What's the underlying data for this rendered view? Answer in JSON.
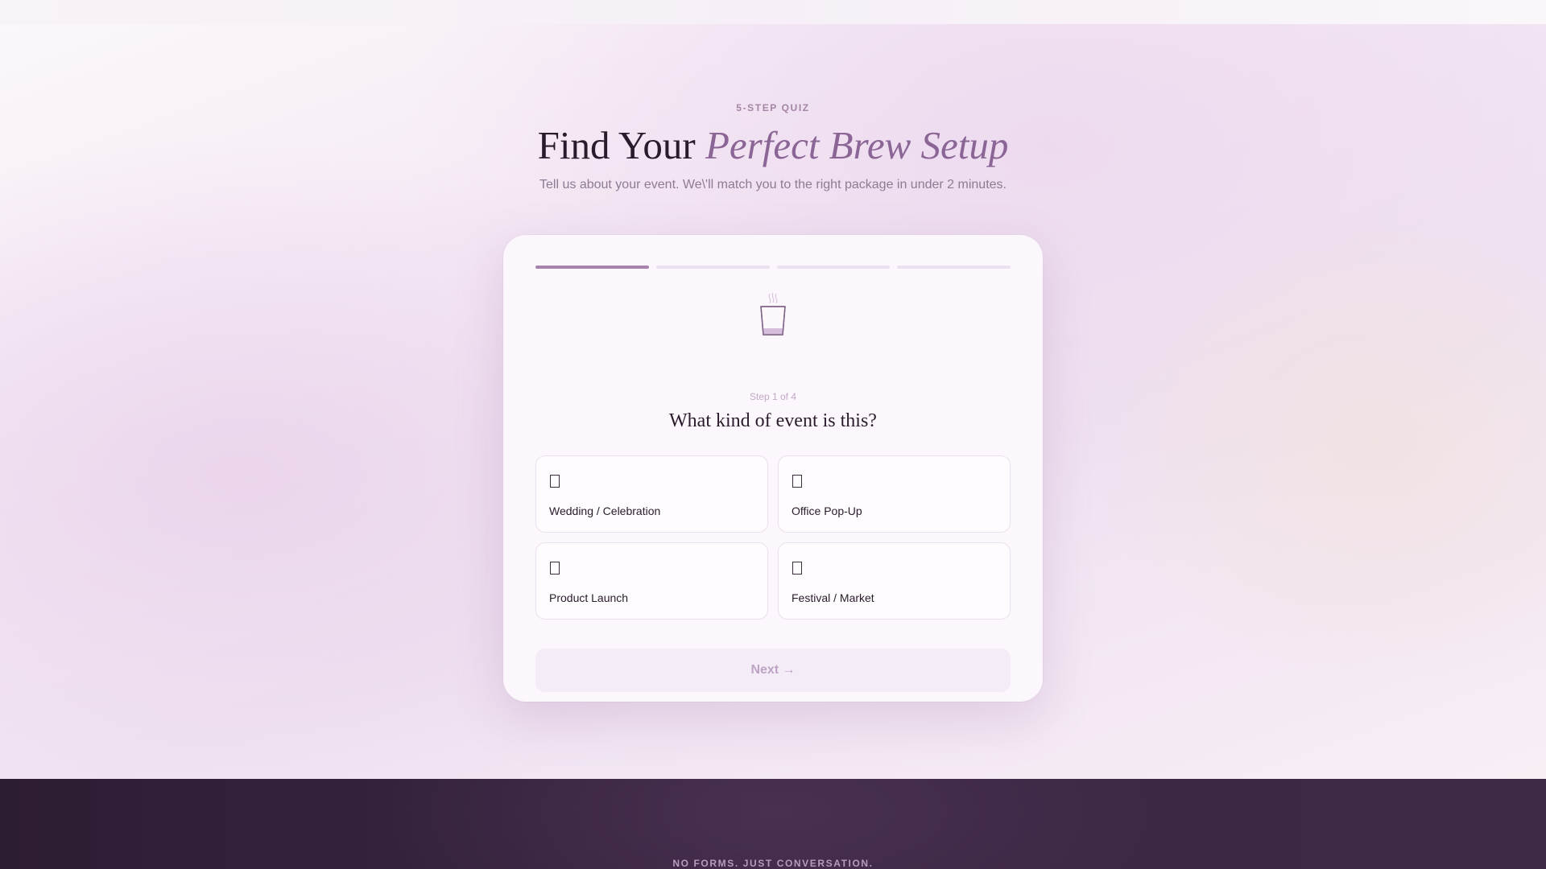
{
  "hero": {
    "eyebrow": "5-STEP QUIZ",
    "title_plain": "Find Your ",
    "title_accent": "Perfect Brew Setup",
    "subtitle": "Tell us about your event. We\\'ll match you to the right package in under 2 minutes."
  },
  "quiz": {
    "progress": {
      "current_step": 1,
      "total_steps": 4
    },
    "step_label": "Step 1 of 4",
    "question": "What kind of event is this?",
    "options": [
      {
        "label": "Wedding / Celebration",
        "icon": "missing-glyph-icon"
      },
      {
        "label": "Office Pop-Up",
        "icon": "missing-glyph-icon"
      },
      {
        "label": "Product Launch",
        "icon": "missing-glyph-icon"
      },
      {
        "label": "Festival / Market",
        "icon": "missing-glyph-icon"
      }
    ],
    "next_label": "Next →",
    "hero_icon": "coffee-cup-icon"
  },
  "footer": {
    "eyebrow": "NO FORMS. JUST CONVERSATION."
  },
  "colors": {
    "accent": "#8a6595",
    "progress_active": "#a683ad",
    "progress_inactive": "#ece2ef",
    "footer_bg": "#35233c"
  }
}
